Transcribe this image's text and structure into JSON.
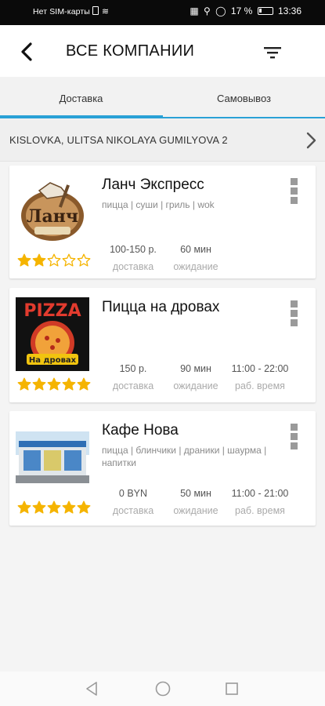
{
  "status_bar": {
    "carrier": "Нет SIM-карты",
    "battery": "17 %",
    "time": "13:36"
  },
  "header": {
    "title": "ВСЕ КОМПАНИИ"
  },
  "tabs": [
    {
      "label": "Доставка",
      "active": true
    },
    {
      "label": "Самовывоз",
      "active": false
    }
  ],
  "address": "KISLOVKA, ULITSA NIKOLAYA GUMILYOVA 2",
  "companies": [
    {
      "name": "Ланч Экспресс",
      "tags": "пицца | суши | гриль | wok",
      "rating": 2,
      "delivery": "100-150 р.",
      "delivery_label": "доставка",
      "wait": "60 мин",
      "wait_label": "ожидание",
      "hours": "",
      "hours_label": "",
      "logo_text": "Ланч"
    },
    {
      "name": "Пицца на дровах",
      "tags": "",
      "rating": 5,
      "delivery": "150 р.",
      "delivery_label": "доставка",
      "wait": "90 мин",
      "wait_label": "ожидание",
      "hours": "11:00 - 22:00",
      "hours_label": "раб. время",
      "logo_text": "PIZZA",
      "logo_subtext": "На дровах"
    },
    {
      "name": "Кафе Нова",
      "tags": "пицца | блинчики | драники | шаурма | напитки",
      "rating": 5,
      "delivery": "0 BYN",
      "delivery_label": "доставка",
      "wait": "50 мин",
      "wait_label": "ожидание",
      "hours": "11:00 - 21:00",
      "hours_label": "раб. время"
    }
  ],
  "colors": {
    "accent": "#2aa1d6",
    "star": "#f5b400",
    "background": "#f4f4f4"
  },
  "icons": [
    "back-arrow-icon",
    "filter-icon",
    "chevron-right-icon",
    "more-vert-icon",
    "star-icon",
    "nav-back-icon",
    "nav-home-icon",
    "nav-recents-icon"
  ]
}
